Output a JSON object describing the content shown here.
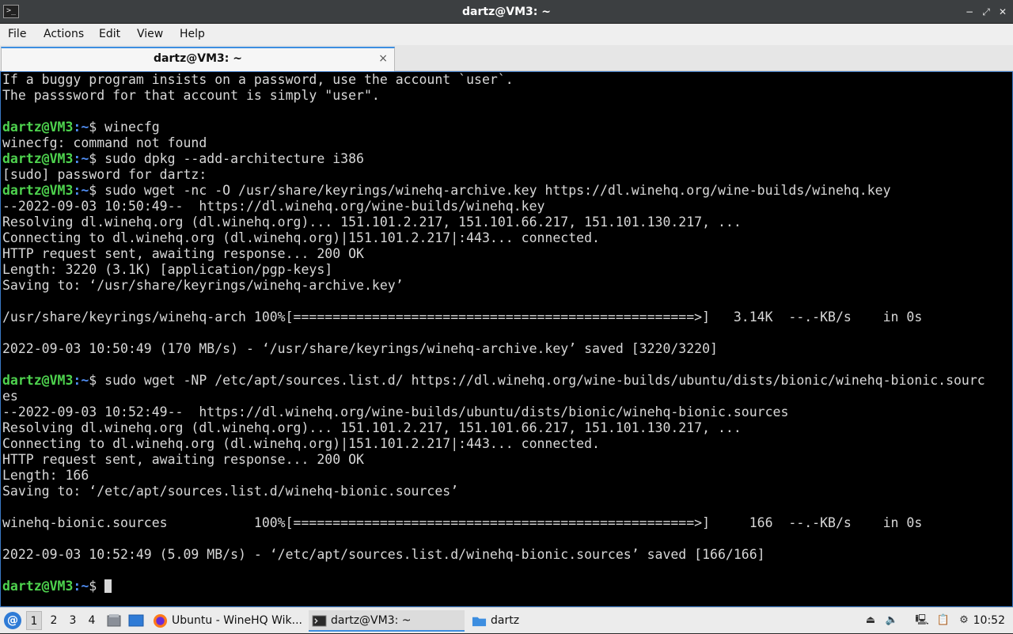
{
  "window": {
    "title": "dartz@VM3: ~",
    "minimize_glyph": "−",
    "maximize_glyph": "⤢",
    "close_glyph": "✕"
  },
  "menu": [
    "File",
    "Actions",
    "Edit",
    "View",
    "Help"
  ],
  "tab": {
    "label": "dartz@VM3: ~",
    "close_glyph": "×"
  },
  "terminal": {
    "user_host": "dartz@VM3",
    "path_sep": ":~",
    "lines": [
      {
        "type": "text",
        "text": "If a buggy program insists on a password, use the account `user`."
      },
      {
        "type": "text",
        "text": "The passsword for that account is simply \"user\"."
      },
      {
        "type": "text",
        "text": ""
      },
      {
        "type": "prompt",
        "text": "$ winecfg"
      },
      {
        "type": "text",
        "text": "winecfg: command not found"
      },
      {
        "type": "prompt",
        "text": "$ sudo dpkg --add-architecture i386"
      },
      {
        "type": "text",
        "text": "[sudo] password for dartz:"
      },
      {
        "type": "prompt",
        "text": "$ sudo wget -nc -O /usr/share/keyrings/winehq-archive.key https://dl.winehq.org/wine-builds/winehq.key"
      },
      {
        "type": "text",
        "text": "--2022-09-03 10:50:49--  https://dl.winehq.org/wine-builds/winehq.key"
      },
      {
        "type": "text",
        "text": "Resolving dl.winehq.org (dl.winehq.org)... 151.101.2.217, 151.101.66.217, 151.101.130.217, ..."
      },
      {
        "type": "text",
        "text": "Connecting to dl.winehq.org (dl.winehq.org)|151.101.2.217|:443... connected."
      },
      {
        "type": "text",
        "text": "HTTP request sent, awaiting response... 200 OK"
      },
      {
        "type": "text",
        "text": "Length: 3220 (3.1K) [application/pgp-keys]"
      },
      {
        "type": "text",
        "text": "Saving to: ‘/usr/share/keyrings/winehq-archive.key’"
      },
      {
        "type": "text",
        "text": ""
      },
      {
        "type": "text",
        "text": "/usr/share/keyrings/winehq-arch 100%[===================================================>]   3.14K  --.-KB/s    in 0s"
      },
      {
        "type": "text",
        "text": ""
      },
      {
        "type": "text",
        "text": "2022-09-03 10:50:49 (170 MB/s) - ‘/usr/share/keyrings/winehq-archive.key’ saved [3220/3220]"
      },
      {
        "type": "text",
        "text": ""
      },
      {
        "type": "prompt",
        "text": "$ sudo wget -NP /etc/apt/sources.list.d/ https://dl.winehq.org/wine-builds/ubuntu/dists/bionic/winehq-bionic.sourc"
      },
      {
        "type": "text",
        "text": "es"
      },
      {
        "type": "text",
        "text": "--2022-09-03 10:52:49--  https://dl.winehq.org/wine-builds/ubuntu/dists/bionic/winehq-bionic.sources"
      },
      {
        "type": "text",
        "text": "Resolving dl.winehq.org (dl.winehq.org)... 151.101.2.217, 151.101.66.217, 151.101.130.217, ..."
      },
      {
        "type": "text",
        "text": "Connecting to dl.winehq.org (dl.winehq.org)|151.101.2.217|:443... connected."
      },
      {
        "type": "text",
        "text": "HTTP request sent, awaiting response... 200 OK"
      },
      {
        "type": "text",
        "text": "Length: 166"
      },
      {
        "type": "text",
        "text": "Saving to: ‘/etc/apt/sources.list.d/winehq-bionic.sources’"
      },
      {
        "type": "text",
        "text": ""
      },
      {
        "type": "text",
        "text": "winehq-bionic.sources           100%[===================================================>]     166  --.-KB/s    in 0s"
      },
      {
        "type": "text",
        "text": ""
      },
      {
        "type": "text",
        "text": "2022-09-03 10:52:49 (5.09 MB/s) - ‘/etc/apt/sources.list.d/winehq-bionic.sources’ saved [166/166]"
      },
      {
        "type": "text",
        "text": ""
      },
      {
        "type": "cursor",
        "text": "$ "
      }
    ]
  },
  "taskbar": {
    "start_icon": "debian-swirl-icon",
    "workspaces": [
      "1",
      "2",
      "3",
      "4"
    ],
    "active_workspace": "1",
    "tasks": [
      {
        "label": "Ubuntu - WineHQ Wik...",
        "icon": "firefox-icon",
        "active": false
      },
      {
        "label": "dartz@VM3: ~",
        "icon": "terminal-icon",
        "active": true
      },
      {
        "label": "dartz",
        "icon": "folder-icon",
        "active": false
      }
    ],
    "clock": "10:52",
    "colors": {
      "accent": "#3d8ee0",
      "prompt_user": "#4ed34e",
      "prompt_path": "#4f8cf0"
    }
  }
}
